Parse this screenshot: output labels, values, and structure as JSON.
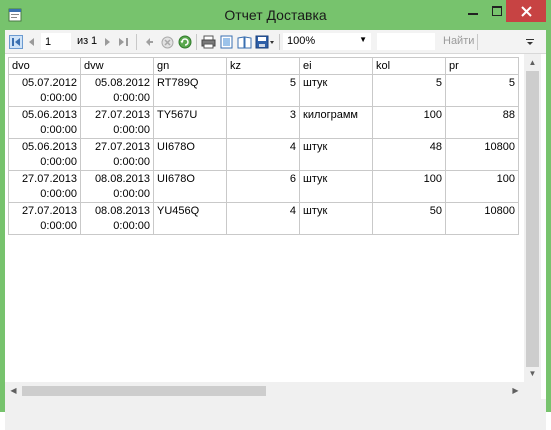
{
  "window": {
    "title": "Отчет Доставка",
    "accent_color": "#77c36d",
    "close_color": "#c74343"
  },
  "toolbar": {
    "current_page": "1",
    "of_label": "из",
    "total_pages": "1",
    "zoom": "100%",
    "find_label": "Найти",
    "icons": [
      "first-page-icon",
      "prev-page-icon",
      "next-page-icon",
      "last-page-icon",
      "back-icon",
      "stop-icon",
      "refresh-icon",
      "print-icon",
      "print-layout-icon",
      "page-setup-icon",
      "export-icon"
    ]
  },
  "report": {
    "columns": [
      "dvo",
      "dvw",
      "gn",
      "kz",
      "ei",
      "kol",
      "pr"
    ],
    "rows": [
      {
        "dvo_date": "05.07.2012",
        "dvo_time": "0:00:00",
        "dvw_date": "05.08.2012",
        "dvw_time": "0:00:00",
        "gn": "RT789Q",
        "kz": "5",
        "ei": "штук",
        "kol": "5",
        "pr": "5"
      },
      {
        "dvo_date": "05.06.2013",
        "dvo_time": "0:00:00",
        "dvw_date": "27.07.2013",
        "dvw_time": "0:00:00",
        "gn": "TY567U",
        "kz": "3",
        "ei": "килограмм",
        "kol": "100",
        "pr": "88"
      },
      {
        "dvo_date": "05.06.2013",
        "dvo_time": "0:00:00",
        "dvw_date": "27.07.2013",
        "dvw_time": "0:00:00",
        "gn": "UI678O",
        "kz": "4",
        "ei": "штук",
        "kol": "48",
        "pr": "10800"
      },
      {
        "dvo_date": "27.07.2013",
        "dvo_time": "0:00:00",
        "dvw_date": "08.08.2013",
        "dvw_time": "0:00:00",
        "gn": "UI678O",
        "kz": "6",
        "ei": "штук",
        "kol": "100",
        "pr": "100"
      },
      {
        "dvo_date": "27.07.2013",
        "dvo_time": "0:00:00",
        "dvw_date": "08.08.2013",
        "dvw_time": "0:00:00",
        "gn": "YU456Q",
        "kz": "4",
        "ei": "штук",
        "kol": "50",
        "pr": "10800"
      }
    ]
  }
}
